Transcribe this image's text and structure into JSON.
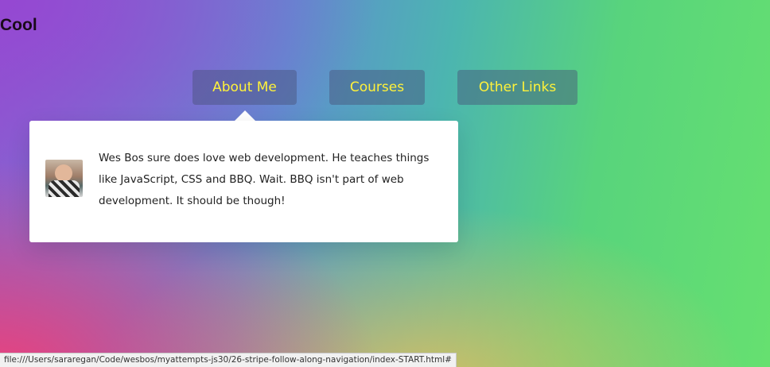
{
  "page": {
    "title": "Cool"
  },
  "nav": {
    "items": [
      {
        "label": "About Me"
      },
      {
        "label": "Courses"
      },
      {
        "label": "Other Links"
      }
    ]
  },
  "dropdown": {
    "avatar_icon": "avatar-photo",
    "bio": "Wes Bos sure does love web development. He teaches things like JavaScript, CSS and BBQ. Wait. BBQ isn't part of web development. It should be though!"
  },
  "status_bar": {
    "url": "file:///Users/sararegan/Code/wesbos/myattempts-js30/26-stripe-follow-along-navigation/index-START.html#"
  },
  "colors": {
    "nav_text": "#fff23a",
    "dropdown_bg": "#ffffff"
  }
}
